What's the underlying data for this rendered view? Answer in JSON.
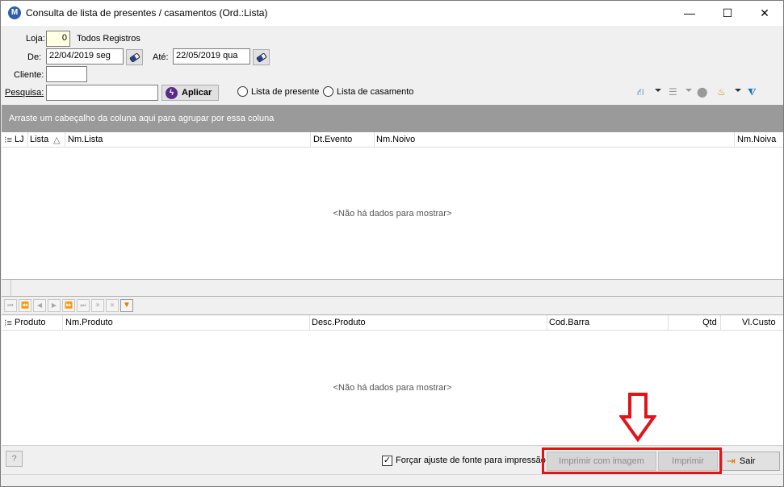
{
  "window": {
    "title": "Consulta de lista de presentes / casamentos (Ord.:Lista)",
    "app_icon_letter": "M",
    "minimize": "—",
    "maximize": "☐",
    "close": "✕"
  },
  "filters": {
    "loja_label": "Loja:",
    "loja_value": "0",
    "loja_desc": "Todos Registros",
    "de_label": "De:",
    "de_value": "22/04/2019 seg",
    "ate_label": "Até:",
    "ate_value": "22/05/2019 qua",
    "cliente_label": "Cliente:",
    "cliente_value": "",
    "pesquisa_label": "Pesquisa:",
    "pesquisa_value": "",
    "apply_label": "Aplicar",
    "radio_lista_presente": "Lista de presente",
    "radio_lista_casamento": "Lista de casamento"
  },
  "group_bar": {
    "text": "Arraste um cabeçalho da coluna aqui para agrupar por essa coluna"
  },
  "grid_top": {
    "columns": [
      "LJ",
      "Lista",
      "Nm.Lista",
      "Dt.Evento",
      "Nm.Noivo",
      "Nm.Noiva"
    ],
    "sort_indicator": "△",
    "empty_text": "<Não há dados para mostrar>"
  },
  "grid_bottom": {
    "columns": [
      "Produto",
      "Nm.Produto",
      "Desc.Produto",
      "Cod.Barra",
      "Qtd",
      "Vl.Custo"
    ],
    "empty_text": "<Não há dados para mostrar>"
  },
  "navigator": {
    "buttons": [
      "⏮",
      "⏪",
      "◀",
      "▶",
      "⏩",
      "⏭",
      "✳",
      "✳",
      "▼"
    ]
  },
  "bottom": {
    "help": "?",
    "force_font_label": "Forçar ajuste de fonte para impressão",
    "force_font_checked": "✓",
    "print_with_image": "Imprimir com imagem",
    "print": "Imprimir",
    "exit": "Sair"
  },
  "colors": {
    "accent_red": "#e2141b",
    "group_bar": "#9a9a9a"
  }
}
